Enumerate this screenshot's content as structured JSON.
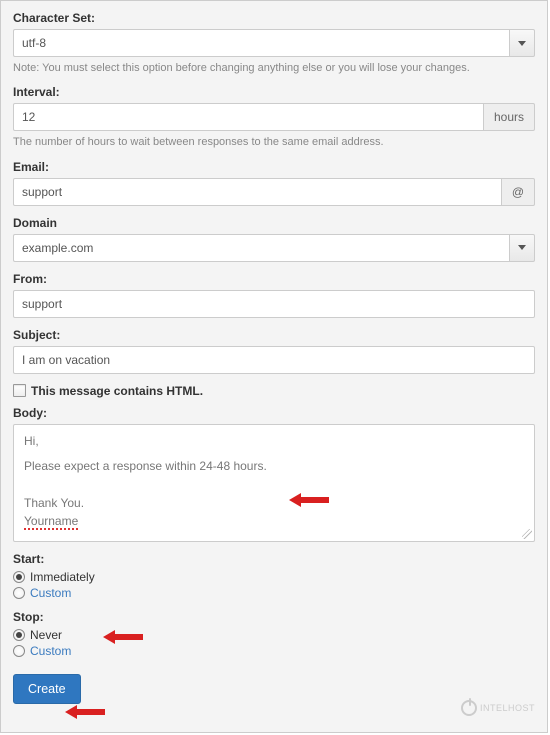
{
  "charset": {
    "label": "Character Set:",
    "value": "utf-8",
    "help": "Note: You must select this option before changing anything else or you will lose your changes."
  },
  "interval": {
    "label": "Interval:",
    "value": "12",
    "unit": "hours",
    "help": "The number of hours to wait between responses to the same email address."
  },
  "email": {
    "label": "Email:",
    "value": "support",
    "addon": "@"
  },
  "domain": {
    "label": "Domain",
    "value": "example.com"
  },
  "from": {
    "label": "From:",
    "value": "support"
  },
  "subject": {
    "label": "Subject:",
    "value": "I am on vacation"
  },
  "html_checkbox": {
    "label": "This message contains HTML.",
    "checked": false
  },
  "body": {
    "label": "Body:",
    "line1": "Hi,",
    "line2": "Please expect a response within 24-48 hours.",
    "line3": "Thank You.",
    "line4": "Yourname"
  },
  "start": {
    "label": "Start:",
    "options": [
      {
        "label": "Immediately",
        "selected": true
      },
      {
        "label": "Custom",
        "selected": false
      }
    ]
  },
  "stop": {
    "label": "Stop:",
    "options": [
      {
        "label": "Never",
        "selected": true
      },
      {
        "label": "Custom",
        "selected": false
      }
    ]
  },
  "create_button": "Create",
  "watermark": "INTELHOST"
}
